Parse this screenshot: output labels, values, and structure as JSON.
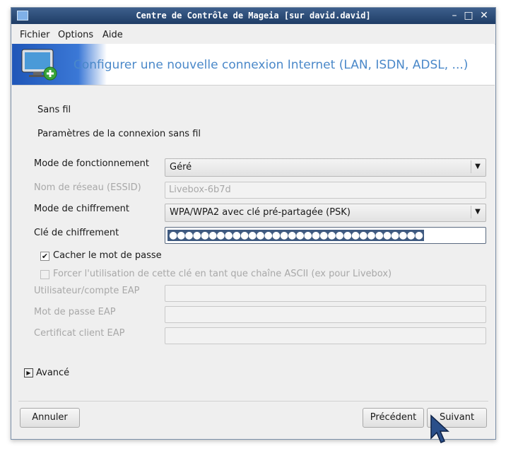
{
  "window": {
    "title": "Centre de Contrôle de Mageia  [sur david.david]",
    "minimize": "–",
    "maximize": "□",
    "close": "✕"
  },
  "menu": [
    "Fichier",
    "Options",
    "Aide"
  ],
  "banner": {
    "title": "Configurer une nouvelle connexion Internet (LAN, ISDN, ADSL, ...)",
    "icon": "monitor-add-icon"
  },
  "section": {
    "type": "Sans fil",
    "subtitle": "Paramètres de la connexion sans fil"
  },
  "form": {
    "mode_label": "Mode de fonctionnement",
    "mode_value": "Géré",
    "essid_label": "Nom de réseau (ESSID)",
    "essid_value": "Livebox-6b7d",
    "encryption_label": "Mode de chiffrement",
    "encryption_value": "WPA/WPA2 avec clé pré-partagée (PSK)",
    "key_label": "Clé de chiffrement",
    "key_value": "●●●●●●●●●●●●●●●●●●●●●●●●●●●●●●●●",
    "hide_password_label": "Cacher le mot de passe",
    "hide_password_checked": true,
    "force_ascii_label": "Forcer l'utilisation de cette clé en tant que chaîne ASCII (ex pour Livebox)",
    "force_ascii_checked": false,
    "eap_user_label": "Utilisateur/compte EAP",
    "eap_password_label": "Mot de passe EAP",
    "eap_cert_label": "Certificat client EAP"
  },
  "advanced_label": "Avancé",
  "buttons": {
    "cancel": "Annuler",
    "previous": "Précédent",
    "next": "Suivant"
  }
}
